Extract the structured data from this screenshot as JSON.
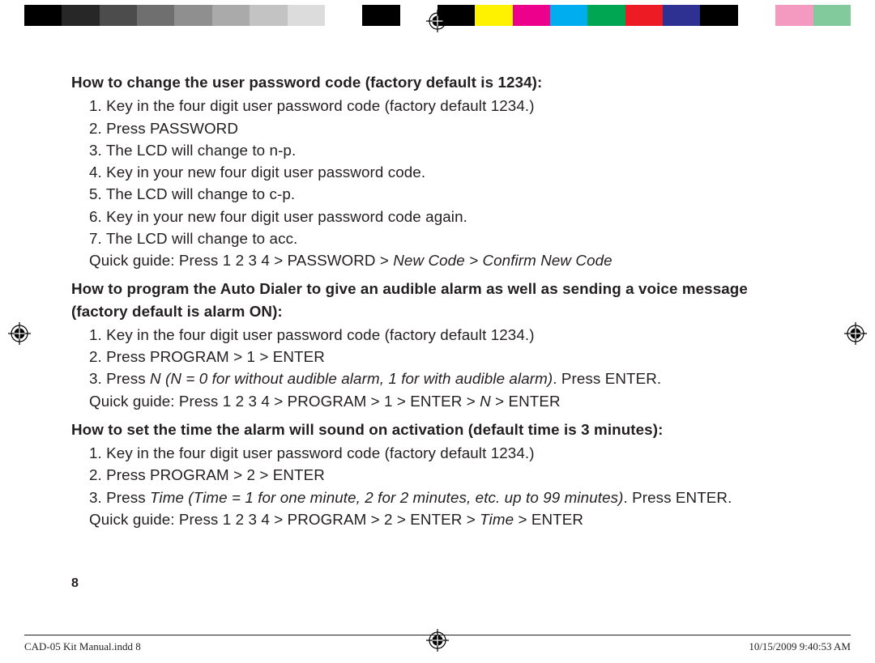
{
  "colorbar": [
    "#000000",
    "#272727",
    "#4c4c4c",
    "#6f6f6f",
    "#8f8f8f",
    "#aaaaaa",
    "#c3c3c3",
    "#dcdcdc",
    "#ffffff",
    "#000000",
    "#ffffff",
    "#000000",
    "#fff200",
    "#ec008c",
    "#00aeef",
    "#00a651",
    "#ed1c24",
    "#2e3192",
    "#000000",
    "#ffffff",
    "#f49ac1",
    "#82ca9c"
  ],
  "sections": [
    {
      "title": "How to change the user password code (factory default is 1234):",
      "steps": [
        "1. Key in the four digit user password code (factory default 1234.)",
        "2. Press PASSWORD",
        "3. The LCD will change to n-p.",
        "4. Key in your new four digit user password code.",
        "5. The LCD will change to c-p.",
        "6. Key in your new four digit user password code again.",
        "7. The LCD will change to acc."
      ],
      "quick_pre": "Quick guide: Press 1 2 3 4 > PASSWORD > ",
      "quick_italic": "New Code > Confirm New Code",
      "quick_post": ""
    },
    {
      "title": "How to program the Auto Dialer to give an audible alarm as well as sending a voice message (factory default is alarm ON):",
      "steps": [
        "1. Key in the four digit user password code (factory default 1234.)",
        "2. Press PROGRAM > 1 > ENTER"
      ],
      "mixed_step": {
        "pre": "3. Press ",
        "i1": "N (N = 0 for without audible alarm, 1 for with audible alarm)",
        "post": ". Press ENTER."
      },
      "quick_pre": "Quick guide: Press 1 2 3 4 > PROGRAM > 1 > ENTER > ",
      "quick_italic": "N",
      "quick_post": " > ENTER"
    },
    {
      "title": "How to set the time the alarm will sound on activation (default time is 3 minutes):",
      "steps": [
        "1. Key in the four digit user password code (factory default 1234.)",
        "2. Press PROGRAM > 2 > ENTER"
      ],
      "mixed_step": {
        "pre": "3. Press ",
        "i1": "Time (Time = 1 for one minute, 2 for 2 minutes, etc. up to 99 minutes)",
        "post": ". Press ENTER."
      },
      "quick_pre": "Quick guide: Press 1 2 3 4 > PROGRAM > 2 > ENTER > ",
      "quick_italic": "Time",
      "quick_post": " > ENTER"
    }
  ],
  "page_number": "8",
  "footer_left": "CAD-05 Kit Manual.indd   8",
  "footer_right": "10/15/2009   9:40:53 AM"
}
